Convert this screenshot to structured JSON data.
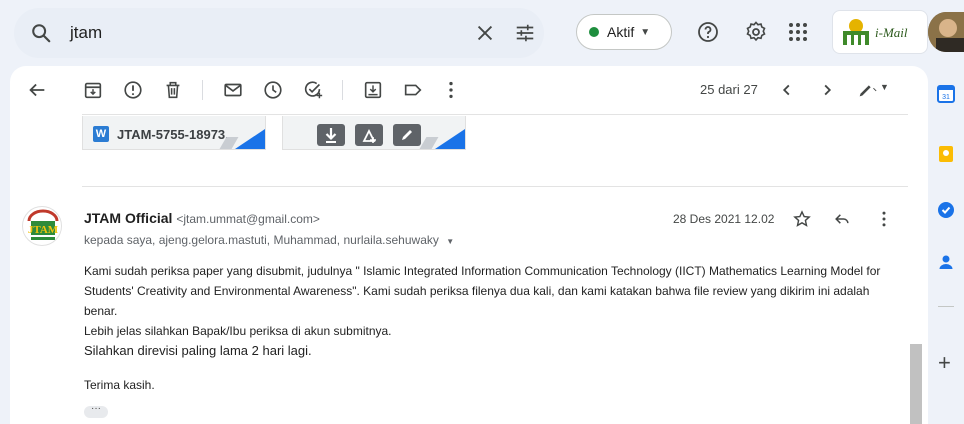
{
  "search": {
    "query": "jtam"
  },
  "status": {
    "label": "Aktif"
  },
  "logo": {
    "text": "i-Mail"
  },
  "toolbar": {
    "pagination": "25 dari 27"
  },
  "attachments": [
    {
      "name": "JTAM-5755-18973..."
    }
  ],
  "message": {
    "sender_name": "JTAM Official",
    "sender_email": "<jtam.ummat@gmail.com>",
    "recipients": "kepada saya, ajeng.gelora.mastuti, Muhammad, nurlaila.sehuwaky",
    "date": "28 Des 2021 12.02",
    "body": [
      "Kami sudah periksa paper yang disubmit, judulnya \" Islamic Integrated Information Communication Technology (IICT) Mathematics Learning Model for Students' Creativity and Environmental Awareness\". Kami sudah periksa filenya dua kali, dan kami katakan bahwa file review yang dikirim ini adalah benar.",
      "Lebih jelas silahkan Bapak/Ibu periksa di akun submitnya.",
      "Silahkan direvisi paling lama 2 hari lagi."
    ],
    "signoff": "Terima kasih."
  },
  "colors": {
    "accent_blue": "#1a73e8",
    "status_green": "#1e8e3e",
    "background": "#eef2f9"
  }
}
